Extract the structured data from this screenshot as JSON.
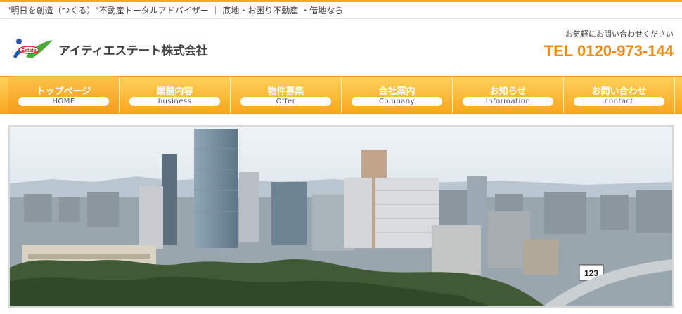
{
  "tagline": "\"明日を創造（つくる）\"不動産トータルアドバイザー ｜ 底地・お困り不動産 ・借地なら",
  "company": {
    "name": "アイティエステート株式会社",
    "logo_text": "Estate"
  },
  "contact": {
    "lead": "お気軽にお問い合わせください",
    "tel": "TEL 0120-973-144"
  },
  "nav": {
    "items": [
      {
        "jp": "トップページ",
        "en": "HOME"
      },
      {
        "jp": "業務内容",
        "en": "business"
      },
      {
        "jp": "物件募集",
        "en": "Offer"
      },
      {
        "jp": "会社案内",
        "en": "Company"
      },
      {
        "jp": "お知らせ",
        "en": "Information"
      },
      {
        "jp": "お問い合わせ",
        "en": "contact"
      }
    ]
  },
  "hero": {
    "sign": "123"
  },
  "colors": {
    "accent": "#f7a21b",
    "tel": "#f08a10",
    "nav_top": "#fdd25c",
    "nav_bottom": "#f9a61e"
  }
}
